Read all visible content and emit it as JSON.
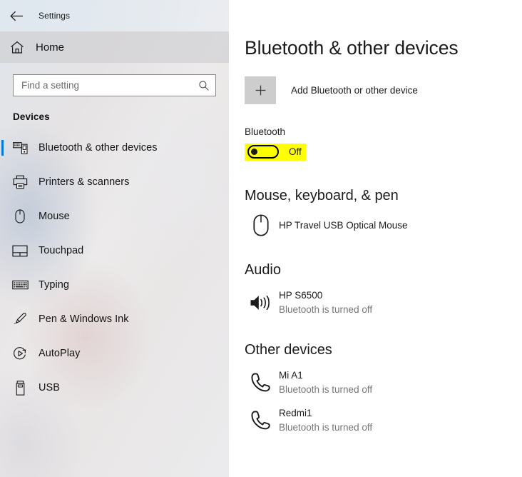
{
  "window": {
    "title": "Settings",
    "back_icon": "back-arrow-icon"
  },
  "sidebar": {
    "home_label": "Home",
    "home_icon": "home-icon",
    "search": {
      "placeholder": "Find a setting",
      "value": "",
      "icon": "search-icon"
    },
    "section_label": "Devices",
    "accent_color": "#0078d7",
    "items": [
      {
        "label": "Bluetooth & other devices",
        "icon": "bluetooth-devices-icon",
        "selected": true
      },
      {
        "label": "Printers & scanners",
        "icon": "printer-icon",
        "selected": false
      },
      {
        "label": "Mouse",
        "icon": "mouse-icon",
        "selected": false
      },
      {
        "label": "Touchpad",
        "icon": "touchpad-icon",
        "selected": false
      },
      {
        "label": "Typing",
        "icon": "keyboard-icon",
        "selected": false
      },
      {
        "label": "Pen & Windows Ink",
        "icon": "pen-icon",
        "selected": false
      },
      {
        "label": "AutoPlay",
        "icon": "autoplay-icon",
        "selected": false
      },
      {
        "label": "USB",
        "icon": "usb-icon",
        "selected": false
      }
    ]
  },
  "main": {
    "page_title": "Bluetooth & other devices",
    "add_device": {
      "label": "Add Bluetooth or other device",
      "icon": "plus-icon"
    },
    "bluetooth": {
      "label": "Bluetooth",
      "state": "Off",
      "toggle_on": false,
      "highlight_color": "#ffff00"
    },
    "sections": [
      {
        "title": "Mouse, keyboard, & pen",
        "devices": [
          {
            "name": "HP Travel USB Optical Mouse",
            "status": "",
            "icon": "mouse-device-icon"
          }
        ]
      },
      {
        "title": "Audio",
        "devices": [
          {
            "name": "HP S6500",
            "status": "Bluetooth is turned off",
            "icon": "speaker-icon"
          }
        ]
      },
      {
        "title": "Other devices",
        "devices": [
          {
            "name": "Mi A1",
            "status": "Bluetooth is turned off",
            "icon": "phone-icon"
          },
          {
            "name": "Redmi1",
            "status": "Bluetooth is turned off",
            "icon": "phone-icon"
          }
        ]
      }
    ]
  }
}
